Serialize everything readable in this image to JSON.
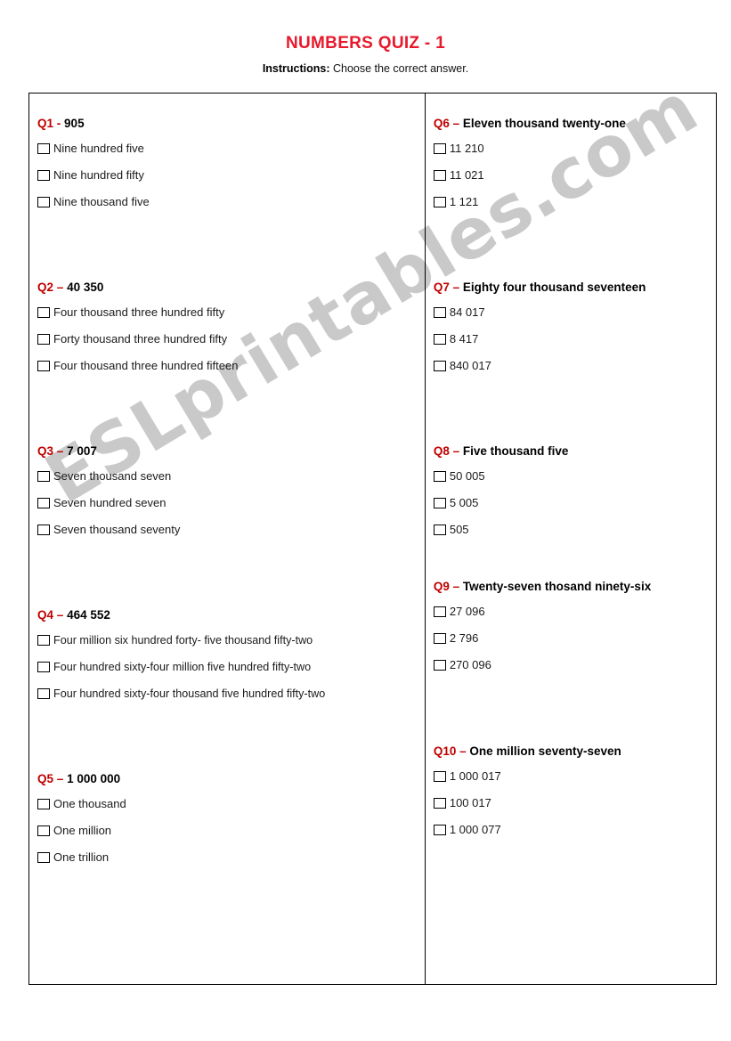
{
  "header": {
    "title": "NUMBERS QUIZ - 1",
    "instructions_label": "Instructions:",
    "instructions_text": " Choose the correct answer."
  },
  "colors": {
    "title_red": "#e8192c",
    "question_red": "#c00000",
    "body_black": "#1a1a1a",
    "border_black": "#000000",
    "watermark_gray": "#c9c9c9"
  },
  "watermark": {
    "text": "ESLprintables.com"
  },
  "columns": {
    "left": [
      {
        "id": "Q1",
        "dash": "-",
        "value": "905",
        "options": [
          "Nine hundred five",
          "Nine hundred fifty",
          "Nine thousand five"
        ]
      },
      {
        "id": "Q2",
        "dash": "–",
        "value": "40 350",
        "options": [
          "Four thousand three hundred fifty",
          "Forty thousand three hundred fifty",
          "Four thousand three hundred fifteen"
        ]
      },
      {
        "id": "Q3",
        "dash": "–",
        "value": "7 007",
        "options": [
          "Seven thousand seven",
          "Seven hundred seven",
          "Seven thousand seventy"
        ]
      },
      {
        "id": "Q4",
        "dash": "–",
        "value": "464 552",
        "options": [
          "Four million six hundred forty- five thousand fifty-two",
          "Four hundred sixty-four million five hundred fifty-two",
          "Four hundred sixty-four thousand five hundred fifty-two"
        ]
      },
      {
        "id": "Q5",
        "dash": "–",
        "value": "1 000 000",
        "options": [
          "One thousand",
          "One million",
          "One trillion"
        ]
      }
    ],
    "right": [
      {
        "id": "Q6",
        "dash": "–",
        "value": "Eleven thousand twenty-one",
        "options": [
          "11 210",
          "11 021",
          "1 121"
        ]
      },
      {
        "id": "Q7",
        "dash": "–",
        "value": "Eighty four thousand seventeen",
        "options": [
          "84 017",
          "8 417",
          "840 017"
        ]
      },
      {
        "id": "Q8",
        "dash": "–",
        "value": "Five thousand five",
        "options": [
          "50 005",
          "5 005",
          "505"
        ]
      },
      {
        "id": "Q9",
        "dash": "–",
        "value": "Twenty-seven thosand ninety-six",
        "options": [
          "27 096",
          "2 796",
          "270 096"
        ]
      },
      {
        "id": "Q10",
        "dash": "–",
        "value": "One million seventy-seven",
        "options": [
          "1 000 017",
          "100 017",
          "1 000 077"
        ]
      }
    ]
  }
}
